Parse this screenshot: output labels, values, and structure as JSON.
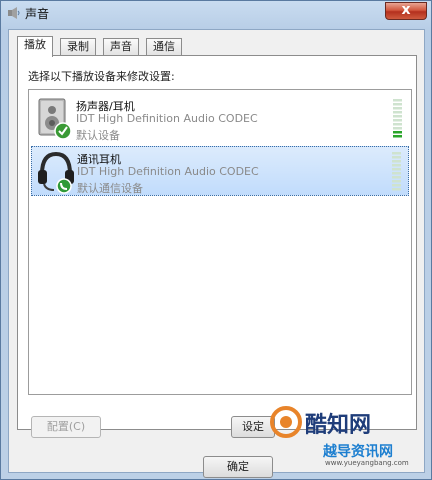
{
  "window": {
    "title": "声音",
    "close_label": "x"
  },
  "tabs": [
    {
      "label": "播放",
      "active": true
    },
    {
      "label": "录制",
      "active": false
    },
    {
      "label": "声音",
      "active": false
    },
    {
      "label": "通信",
      "active": false
    }
  ],
  "panel": {
    "instruction": "选择以下播放设备来修改设置:"
  },
  "devices": [
    {
      "name": "扬声器/耳机",
      "description": "IDT High Definition Audio CODEC",
      "status": "默认设备",
      "icon": "speaker-icon",
      "badge": "check-icon",
      "selected": false,
      "level": 0.15
    },
    {
      "name": "通讯耳机",
      "description": "IDT High Definition Audio CODEC",
      "status": "默认通信设备",
      "icon": "headset-icon",
      "badge": "phone-icon",
      "selected": true,
      "level": 0.0
    }
  ],
  "buttons": {
    "configure": "配置(C)",
    "set_default": "设定",
    "ok": "确定"
  },
  "watermark": {
    "brand": "酷知网",
    "sub": "越导资讯网",
    "url": "www.yueyangbang.com"
  },
  "colors": {
    "accent": "#3c6ea5",
    "meter_green": "#2aa52a",
    "close_red": "#c7432d"
  }
}
